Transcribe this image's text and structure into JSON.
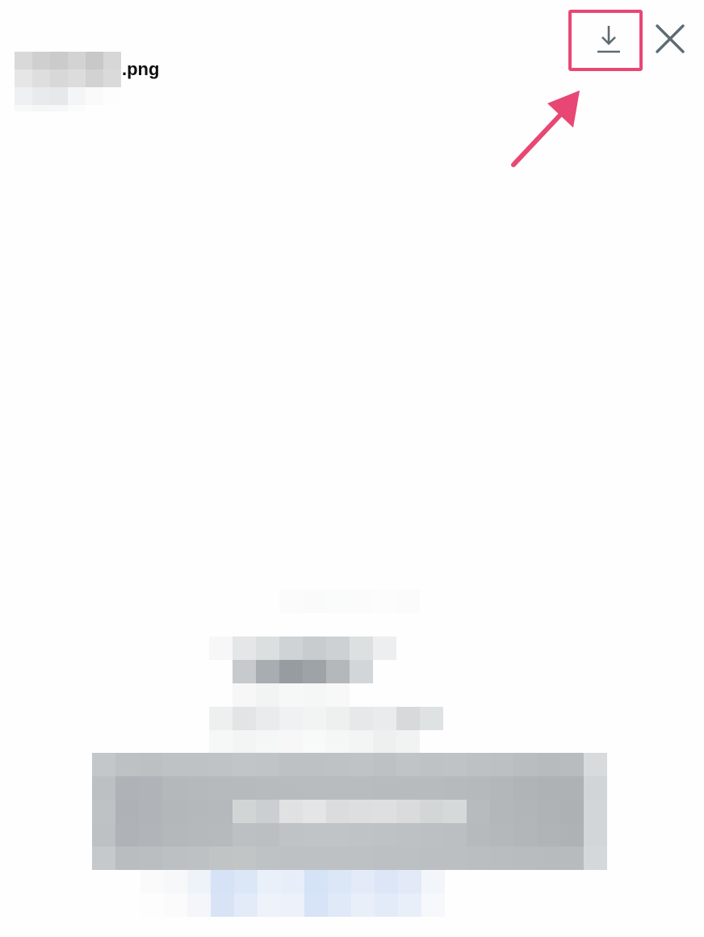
{
  "file": {
    "extension_label": ".png"
  },
  "toolbar": {
    "download_icon": "download-icon",
    "close_icon": "close-icon"
  },
  "annotation": {
    "box_color": "#e84774",
    "arrow_icon": "arrow-up-right-icon"
  },
  "colors": {
    "icon": "#5f6b73",
    "accent": "#e84774"
  }
}
